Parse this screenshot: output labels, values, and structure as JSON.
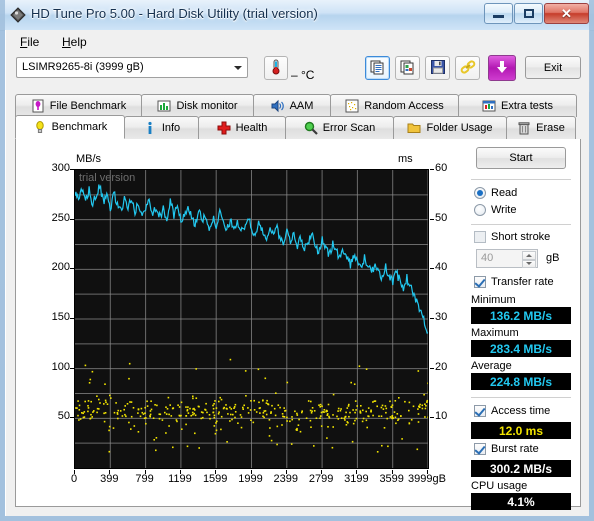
{
  "window": {
    "title": "HD Tune Pro 5.00 - Hard Disk Utility (trial version)",
    "app_icon": "diamond-icon",
    "minimize_label": "",
    "maximize_label": "",
    "close_label": "✕"
  },
  "menu": {
    "items": [
      {
        "label": "File",
        "accel": "F"
      },
      {
        "label": "Help",
        "accel": "H"
      }
    ]
  },
  "toolbar": {
    "drive_selected": "LSIMR9265-8i (3999 gB)",
    "drive_options": [
      "LSIMR9265-8i (3999 gB)"
    ],
    "temperature": "– °C",
    "thermometer_icon": "thermometer-icon",
    "buttons": [
      {
        "name": "copy-text-button",
        "icon": "copy-text-icon",
        "selected": true
      },
      {
        "name": "copy-image-button",
        "icon": "copy-image-icon",
        "selected": false
      },
      {
        "name": "save-button",
        "icon": "floppy-disk-icon",
        "selected": false
      },
      {
        "name": "link-button",
        "icon": "chain-link-icon",
        "selected": false
      },
      {
        "name": "download-button",
        "icon": "download-arrow-icon",
        "selected": false
      }
    ],
    "exit_label": "Exit"
  },
  "tabs": {
    "row1": [
      {
        "label": "File Benchmark",
        "icon": "file-benchmark-icon",
        "active": false,
        "width": 127
      },
      {
        "label": "Disk monitor",
        "icon": "bar-chart-icon",
        "active": false,
        "width": 113
      },
      {
        "label": "AAM",
        "icon": "speaker-icon",
        "active": false,
        "width": 78
      },
      {
        "label": "Random Access",
        "icon": "scatter-icon",
        "active": false,
        "width": 129
      },
      {
        "label": "Extra tests",
        "icon": "extra-tests-icon",
        "active": false,
        "width": 119
      }
    ],
    "row2": [
      {
        "label": "Benchmark",
        "icon": "lightbulb-icon",
        "active": true,
        "width": 110
      },
      {
        "label": "Info",
        "icon": "info-icon",
        "active": false,
        "width": 75
      },
      {
        "label": "Health",
        "icon": "red-cross-icon",
        "active": false,
        "width": 88
      },
      {
        "label": "Error Scan",
        "icon": "magnifier-icon",
        "active": false,
        "width": 109
      },
      {
        "label": "Folder Usage",
        "icon": "folder-icon",
        "active": false,
        "width": 114
      },
      {
        "label": "Erase",
        "icon": "trash-icon",
        "active": false,
        "width": 70
      }
    ]
  },
  "sidebar": {
    "start_label": "Start",
    "mode": {
      "read_label": "Read",
      "write_label": "Write",
      "selected": "Read"
    },
    "short_stroke": {
      "label": "Short stroke",
      "checked": false,
      "value": "40",
      "unit": "gB"
    },
    "transfer_rate": {
      "label": "Transfer rate",
      "checked": true,
      "minimum_label": "Minimum",
      "minimum_value": "136.2 MB/s",
      "maximum_label": "Maximum",
      "maximum_value": "283.4 MB/s",
      "average_label": "Average",
      "average_value": "224.8 MB/s"
    },
    "access_time": {
      "label": "Access time",
      "checked": true,
      "value": "12.0 ms"
    },
    "burst_rate": {
      "label": "Burst rate",
      "checked": true,
      "value": "300.2 MB/s"
    },
    "cpu_usage": {
      "label": "CPU usage",
      "value": "4.1%"
    },
    "colors": {
      "transfer": "#22c8f0",
      "access": "#f2e400",
      "plain": "#ffffff"
    }
  },
  "chart_data": {
    "type": "line",
    "title": "",
    "watermark": "trial version",
    "xlabel": "",
    "ylabel": "MB/s",
    "y2label": "ms",
    "xticks": [
      "0",
      "399",
      "799",
      "1199",
      "1599",
      "1999",
      "2399",
      "2799",
      "3199",
      "3599",
      "3999gB"
    ],
    "xlim": [
      0,
      3999
    ],
    "yticks": [
      300,
      250,
      200,
      150,
      100,
      50
    ],
    "ylim": [
      0,
      300
    ],
    "y2ticks": [
      60,
      50,
      40,
      30,
      20,
      10
    ],
    "y2lim": [
      0,
      60
    ],
    "grid": true,
    "plot_bg": "#101010",
    "grid_color": "#8a8a8a",
    "series": [
      {
        "name": "Transfer rate",
        "color": "#22c8f0",
        "axis": "left",
        "unit": "MB/s",
        "x": [
          0,
          40,
          80,
          120,
          160,
          200,
          240,
          280,
          320,
          360,
          400,
          440,
          480,
          520,
          560,
          600,
          640,
          680,
          720,
          760,
          800,
          840,
          880,
          920,
          960,
          1000,
          1040,
          1080,
          1120,
          1160,
          1200,
          1240,
          1280,
          1320,
          1360,
          1400,
          1440,
          1480,
          1520,
          1560,
          1600,
          1640,
          1680,
          1720,
          1760,
          1800,
          1840,
          1880,
          1920,
          1960,
          2000,
          2040,
          2080,
          2120,
          2160,
          2200,
          2240,
          2280,
          2320,
          2360,
          2400,
          2440,
          2480,
          2520,
          2560,
          2600,
          2640,
          2680,
          2720,
          2760,
          2800,
          2840,
          2880,
          2920,
          2960,
          3000,
          3040,
          3080,
          3120,
          3160,
          3200,
          3240,
          3280,
          3320,
          3360,
          3400,
          3440,
          3480,
          3520,
          3560,
          3600,
          3640,
          3680,
          3720,
          3760,
          3800,
          3840,
          3880,
          3920,
          3960,
          3999
        ],
        "values": [
          274,
          272,
          278,
          268,
          281,
          264,
          275,
          283,
          268,
          272,
          262,
          277,
          266,
          258,
          271,
          263,
          270,
          258,
          266,
          252,
          262,
          269,
          258,
          264,
          253,
          261,
          250,
          268,
          255,
          262,
          248,
          256,
          263,
          252,
          246,
          258,
          249,
          254,
          243,
          251,
          245,
          256,
          247,
          238,
          250,
          241,
          248,
          236,
          244,
          252,
          241,
          234,
          246,
          238,
          230,
          242,
          235,
          243,
          232,
          228,
          238,
          230,
          236,
          224,
          231,
          220,
          228,
          235,
          226,
          218,
          229,
          221,
          214,
          226,
          218,
          210,
          221,
          213,
          205,
          216,
          208,
          200,
          212,
          203,
          196,
          207,
          199,
          191,
          202,
          194,
          186,
          197,
          188,
          180,
          191,
          182,
          174,
          165,
          157,
          148,
          136
        ]
      },
      {
        "name": "Access time",
        "color": "#f2e400",
        "axis": "right",
        "unit": "ms",
        "average": 12.0,
        "point_count": 560,
        "x_range": [
          0,
          3999
        ],
        "y_range": [
          2,
          22
        ],
        "density_note": "dense scatter clustered 7-16 ms, thinning toward right"
      }
    ]
  }
}
